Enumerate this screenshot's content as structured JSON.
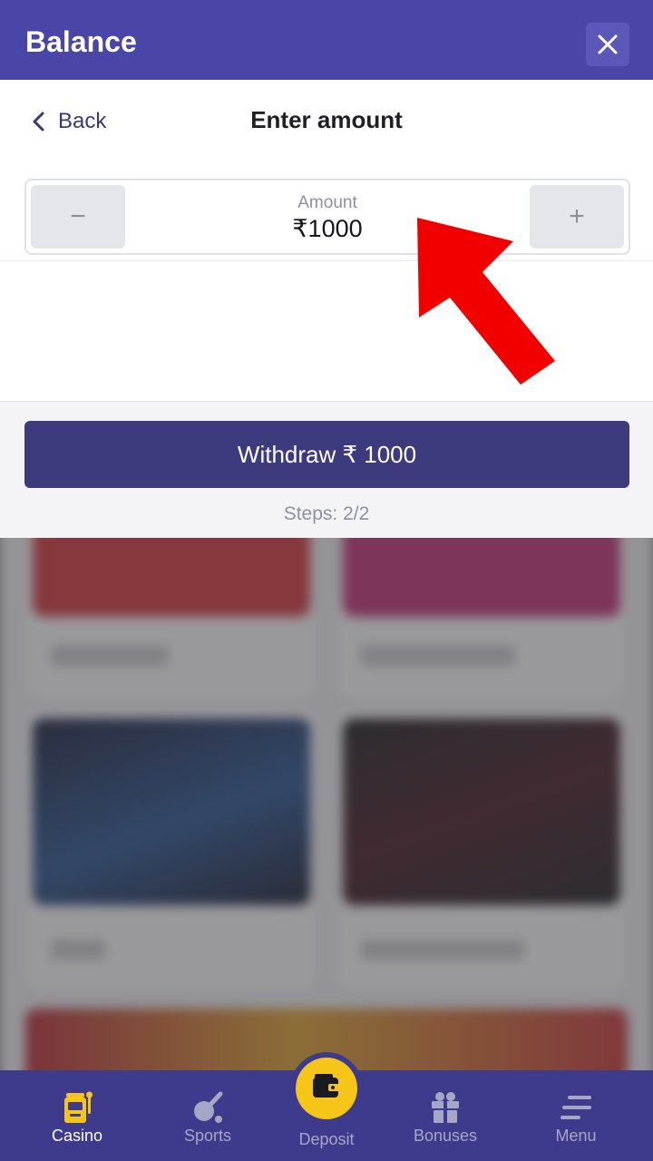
{
  "header": {
    "title": "Balance",
    "close_icon": "close-icon"
  },
  "panel": {
    "back_label": "Back",
    "title": "Enter amount",
    "amount": {
      "label": "Amount",
      "value": "₹1000",
      "minus": "−",
      "plus": "+"
    },
    "withdraw_label": "Withdraw ₹ 1000",
    "steps": "Steps: 2/2"
  },
  "bottom_nav": {
    "items": [
      {
        "label": "Casino",
        "icon": "slot-machine-icon",
        "active": true
      },
      {
        "label": "Sports",
        "icon": "sports-icon",
        "active": false
      },
      {
        "label": "Deposit",
        "icon": "wallet-icon",
        "active": false
      },
      {
        "label": "Bonuses",
        "icon": "gift-icon",
        "active": false
      },
      {
        "label": "Menu",
        "icon": "menu-icon",
        "active": false
      }
    ]
  },
  "colors": {
    "brand": "#4a46a8",
    "button": "#3e3a7e",
    "nav": "#3e3a8c",
    "accent": "#f5c518",
    "annotation_arrow": "#f20000"
  }
}
